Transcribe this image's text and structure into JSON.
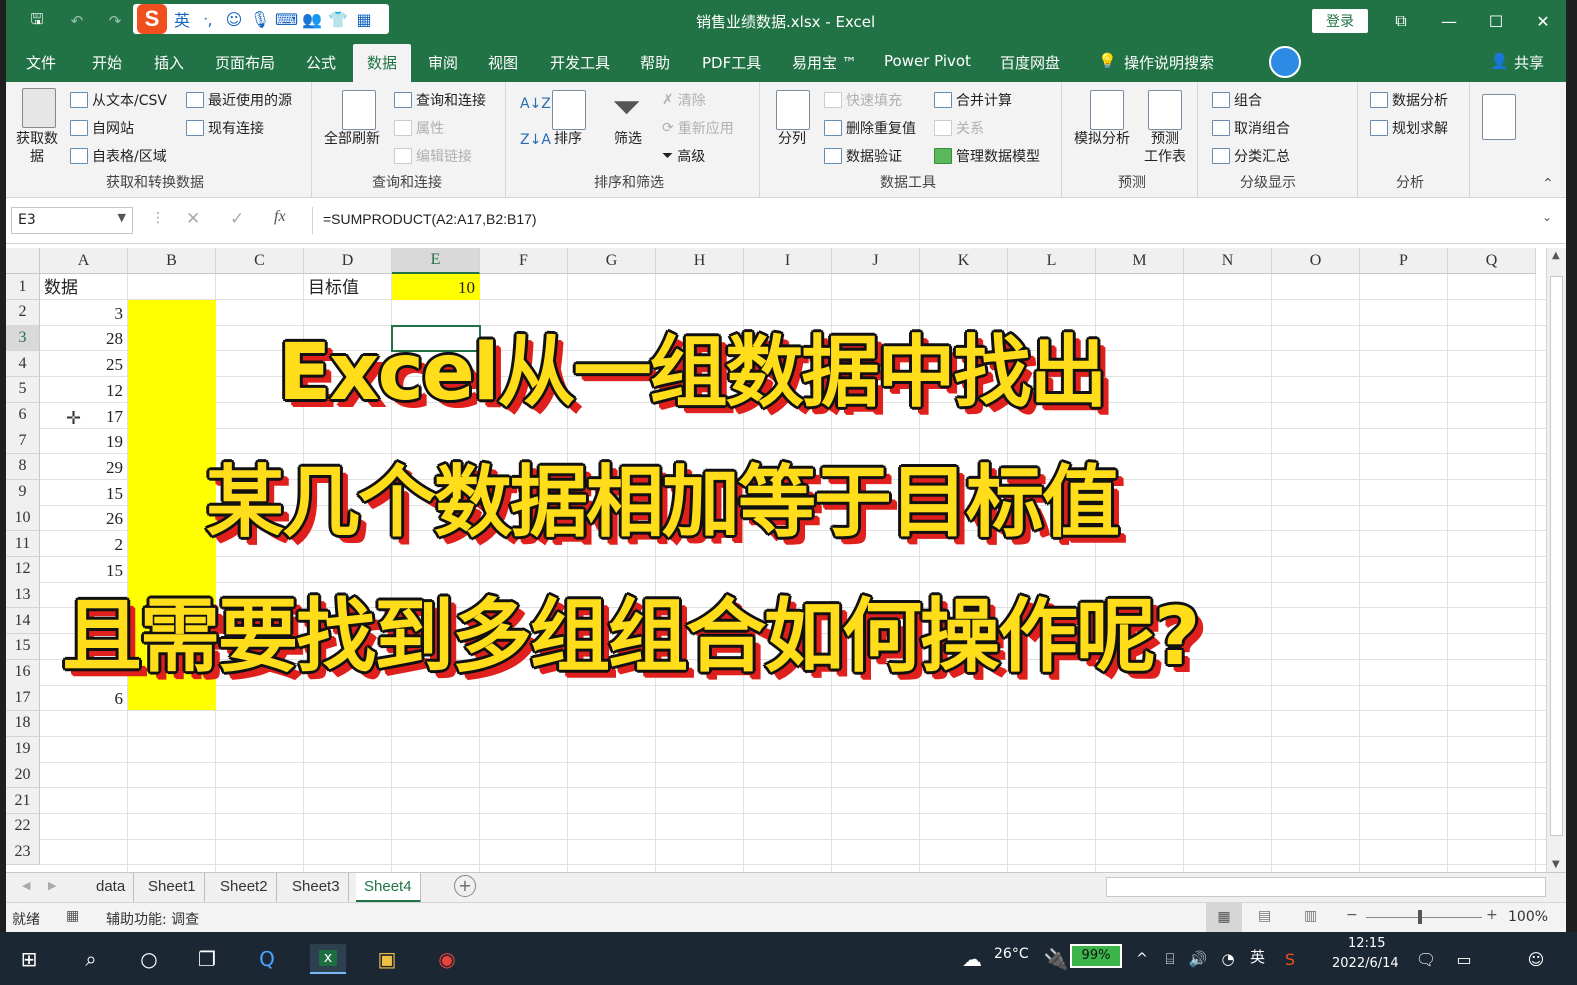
{
  "titlebar": {
    "doc_title": "销售业绩数据.xlsx  -  Excel",
    "login": "登录"
  },
  "ime": {
    "logo": "S",
    "lang": "英",
    "items": [
      "ᐧ,",
      "☺",
      "🎙",
      "⌨",
      "👥",
      "👕",
      "▦"
    ]
  },
  "tabs": [
    "文件",
    "开始",
    "插入",
    "页面布局",
    "公式",
    "数据",
    "审阅",
    "视图",
    "开发工具",
    "帮助",
    "PDF工具",
    "易用宝 ™",
    "Power Pivot",
    "百度网盘",
    "操作说明搜索"
  ],
  "share": "共享",
  "ribbon": {
    "get": {
      "big": "获取数\n据",
      "items": [
        "从文本/CSV",
        "自网站",
        "自表格/区域",
        "最近使用的源",
        "现有连接"
      ],
      "label": "获取和转换数据"
    },
    "query": {
      "big": "全部刷新",
      "items": [
        "查询和连接",
        "属性",
        "编辑链接"
      ],
      "label": "查询和连接"
    },
    "sort": {
      "sort": "排序",
      "filter": "筛选",
      "items": [
        "清除",
        "重新应用",
        "高级"
      ],
      "label": "排序和筛选"
    },
    "tools": {
      "split": "分列",
      "items": [
        "快速填充",
        "删除重复值",
        "数据验证",
        "合并计算",
        "关系",
        "管理数据模型"
      ],
      "label": "数据工具"
    },
    "forecast": {
      "whatif": "模拟分析",
      "sheet": "预测\n工作表",
      "label": "预测"
    },
    "outline": {
      "items": [
        "组合",
        "取消组合",
        "分类汇总"
      ],
      "label": "分级显示"
    },
    "analysis": {
      "items": [
        "数据分析",
        "规划求解"
      ],
      "label": "分析"
    }
  },
  "formula_bar": {
    "name_box": "E3",
    "fx": "fx",
    "formula": "=SUMPRODUCT(A2:A17,B2:B17)"
  },
  "columns": [
    "A",
    "B",
    "C",
    "D",
    "E",
    "F",
    "G",
    "H",
    "I",
    "J",
    "K",
    "L",
    "M",
    "N",
    "O",
    "P",
    "Q"
  ],
  "rows": [
    "1",
    "2",
    "3",
    "4",
    "5",
    "6",
    "7",
    "8",
    "9",
    "10",
    "11",
    "12",
    "13",
    "14",
    "15",
    "16",
    "17",
    "18",
    "19",
    "20",
    "21",
    "22",
    "23"
  ],
  "cells": {
    "a1": "数据",
    "d1": "目标值",
    "e1": "10",
    "a_values": [
      "3",
      "28",
      "25",
      "12",
      "17",
      "19",
      "29",
      "15",
      "26",
      "2",
      "15",
      "",
      "",
      "",
      "",
      "6"
    ]
  },
  "caption": [
    "Excel从一组数据中找出",
    "某几个数据相加等于目标值",
    "且需要找到多组组合如何操作呢?"
  ],
  "sheets": [
    "data",
    "Sheet1",
    "Sheet2",
    "Sheet3",
    "Sheet4"
  ],
  "status": {
    "ready": "就绪",
    "accessibility": "辅助功能: 调查",
    "zoom": "100%"
  },
  "taskbar": {
    "weather": "26°C",
    "battery": "99%",
    "lang": "英",
    "time": "12:15",
    "date": "2022/6/14"
  },
  "colors": {
    "excel_green": "#217346",
    "highlight": "#ffff00",
    "caption": "#ffdd1a",
    "caption_shadow": "#e0201c"
  }
}
